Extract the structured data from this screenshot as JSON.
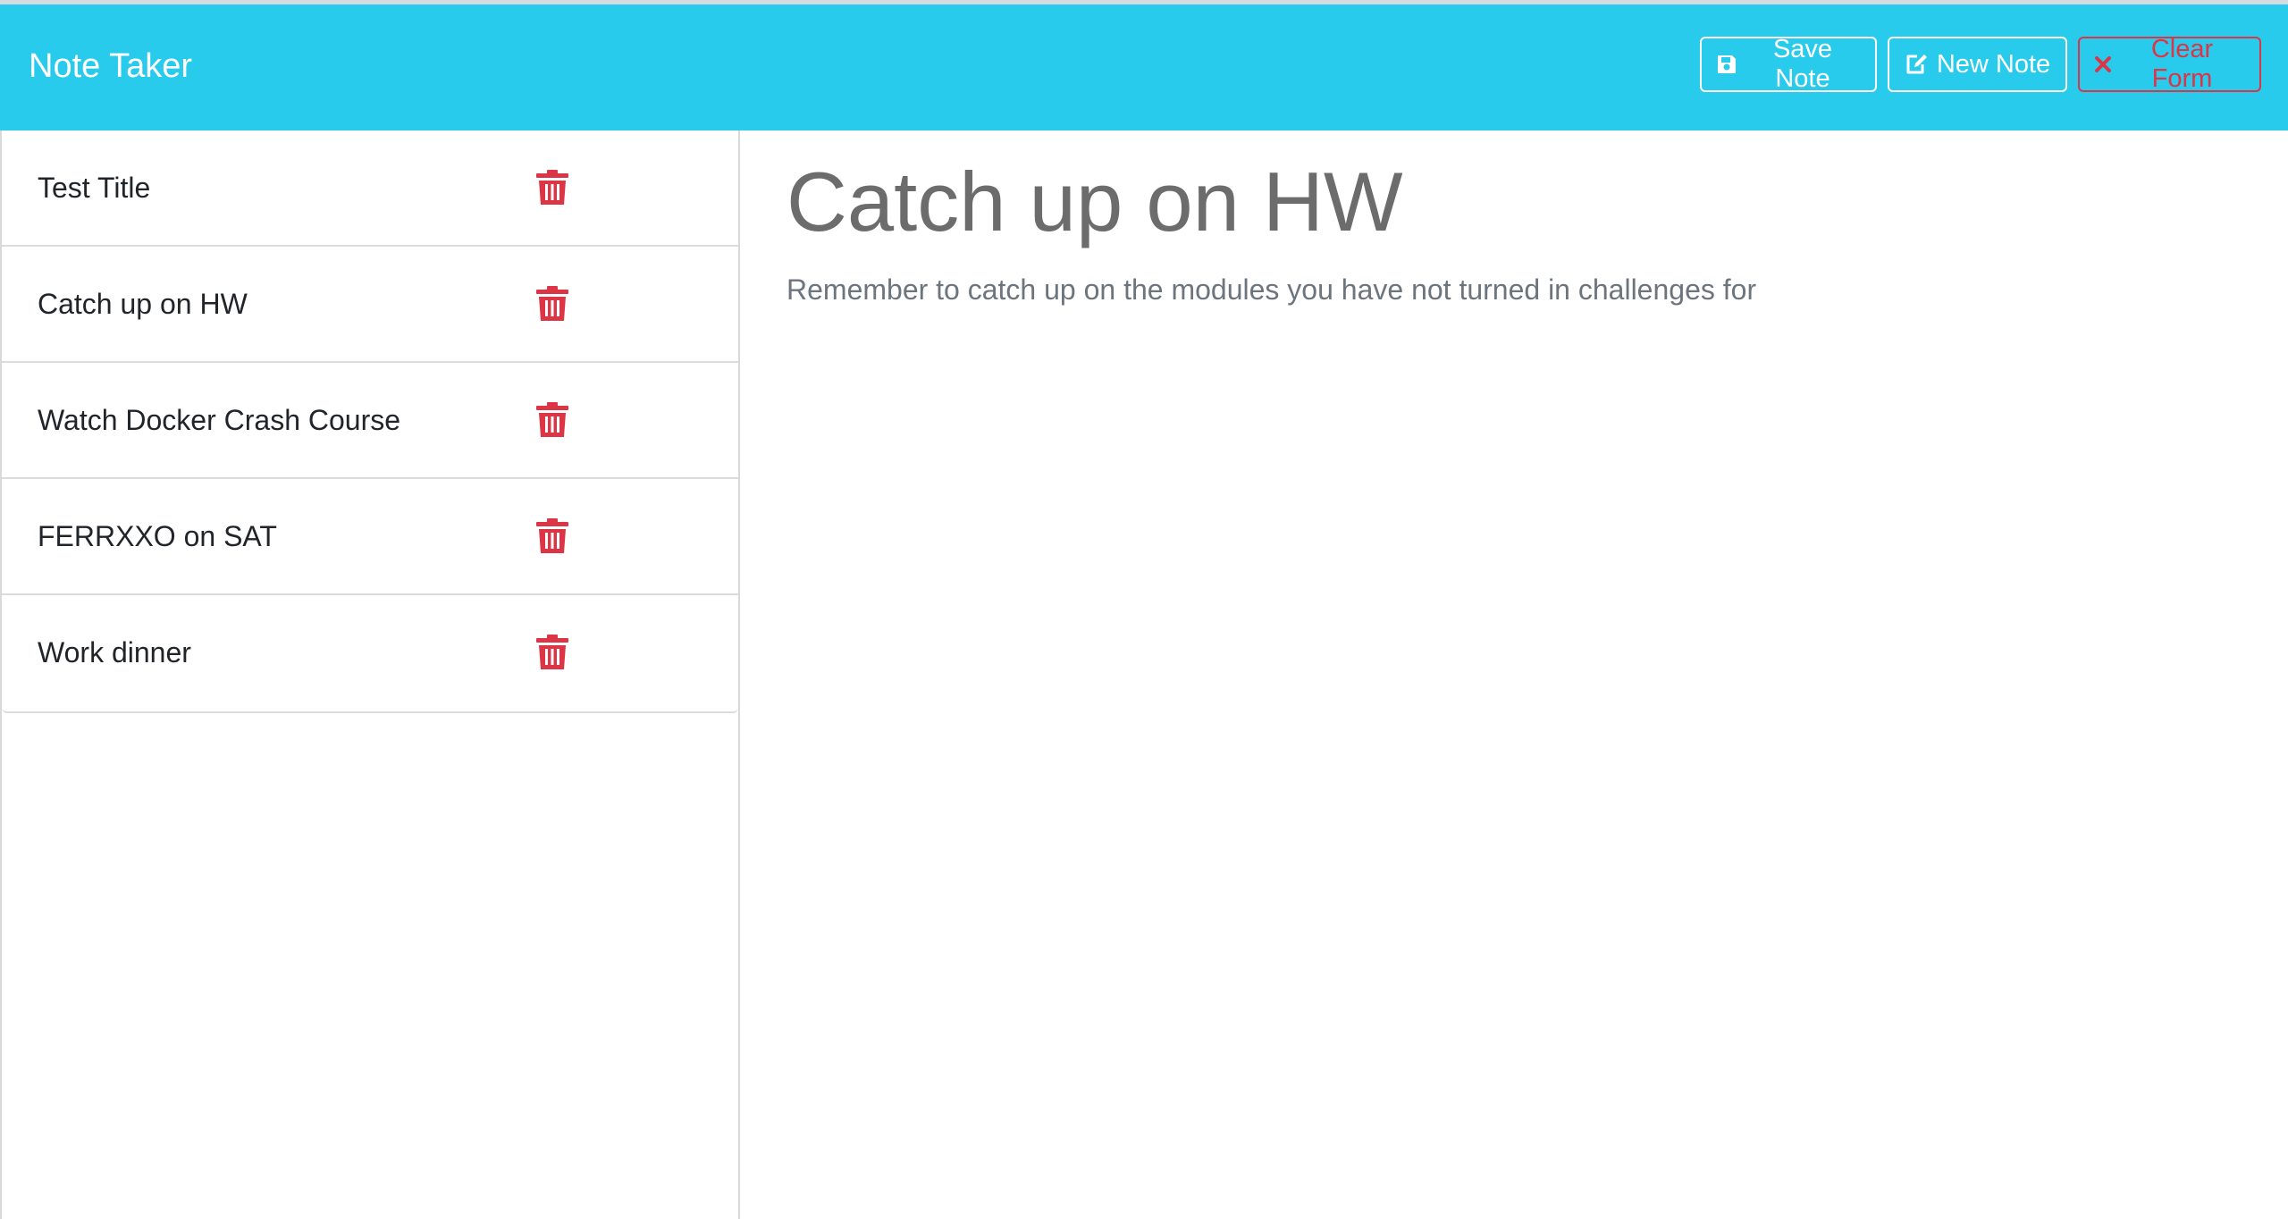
{
  "app": {
    "title": "Note Taker"
  },
  "toolbar": {
    "save_label": "Save Note",
    "new_label": "New Note",
    "clear_label": "Clear Form"
  },
  "notes": [
    {
      "title": "Test Title"
    },
    {
      "title": "Catch up on HW"
    },
    {
      "title": "Watch Docker Crash Course"
    },
    {
      "title": "FERRXXO on SAT"
    },
    {
      "title": "Work dinner"
    }
  ],
  "active_note": {
    "title": "Catch up on HW",
    "text": "Remember to catch up on the modules you have not turned in challenges for"
  },
  "icons": {
    "save": "floppy-disk-icon",
    "new": "pen-to-square-icon",
    "clear": "x-mark-icon",
    "delete": "trash-icon"
  },
  "colors": {
    "navbar": "#29cbed",
    "danger": "#dc3545",
    "text_muted": "#6c757d"
  }
}
